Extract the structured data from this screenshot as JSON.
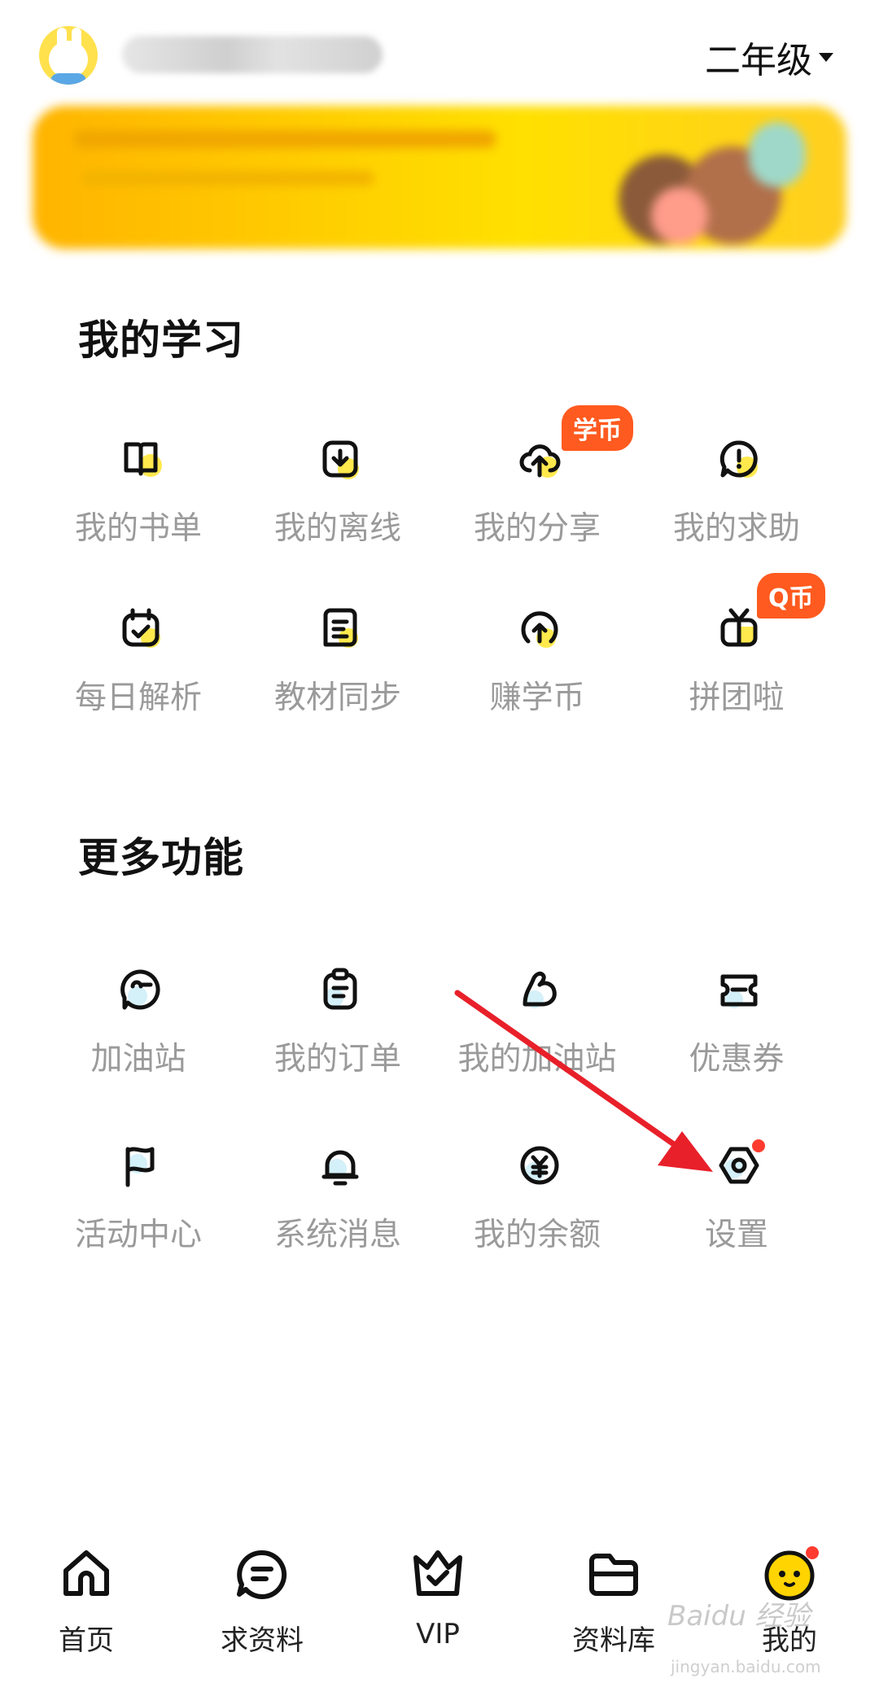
{
  "header": {
    "grade_label": "二年级"
  },
  "sections": {
    "study": {
      "title": "我的学习",
      "items": [
        {
          "label": "我的书单",
          "icon": "book-icon"
        },
        {
          "label": "我的离线",
          "icon": "download-icon"
        },
        {
          "label": "我的分享",
          "icon": "cloud-upload-icon",
          "badge": "学币"
        },
        {
          "label": "我的求助",
          "icon": "help-bubble-icon"
        },
        {
          "label": "每日解析",
          "icon": "calendar-check-icon"
        },
        {
          "label": "教材同步",
          "icon": "textbook-icon"
        },
        {
          "label": "赚学币",
          "icon": "coin-arrow-icon"
        },
        {
          "label": "拼团啦",
          "icon": "gift-icon",
          "badge": "Q币"
        }
      ]
    },
    "more": {
      "title": "更多功能",
      "items": [
        {
          "label": "加油站",
          "icon": "face-icon"
        },
        {
          "label": "我的订单",
          "icon": "clipboard-icon"
        },
        {
          "label": "我的加油站",
          "icon": "muscle-icon"
        },
        {
          "label": "优惠券",
          "icon": "ticket-icon"
        },
        {
          "label": "活动中心",
          "icon": "flag-icon"
        },
        {
          "label": "系统消息",
          "icon": "bell-icon"
        },
        {
          "label": "我的余额",
          "icon": "yen-icon"
        },
        {
          "label": "设置",
          "icon": "gear-icon"
        }
      ]
    }
  },
  "bottom_nav": [
    {
      "label": "首页",
      "icon": "home-icon"
    },
    {
      "label": "求资料",
      "icon": "chat-icon"
    },
    {
      "label": "VIP",
      "icon": "crown-icon"
    },
    {
      "label": "资料库",
      "icon": "folder-icon"
    },
    {
      "label": "我的",
      "icon": "smiley-icon"
    }
  ],
  "watermark": {
    "brand": "Baidu 经验",
    "url": "jingyan.baidu.com"
  },
  "colors": {
    "accent": "#ffd400",
    "badge": "#ff5a1f",
    "dot": "#ff3b30",
    "arrow": "#e8202a"
  }
}
